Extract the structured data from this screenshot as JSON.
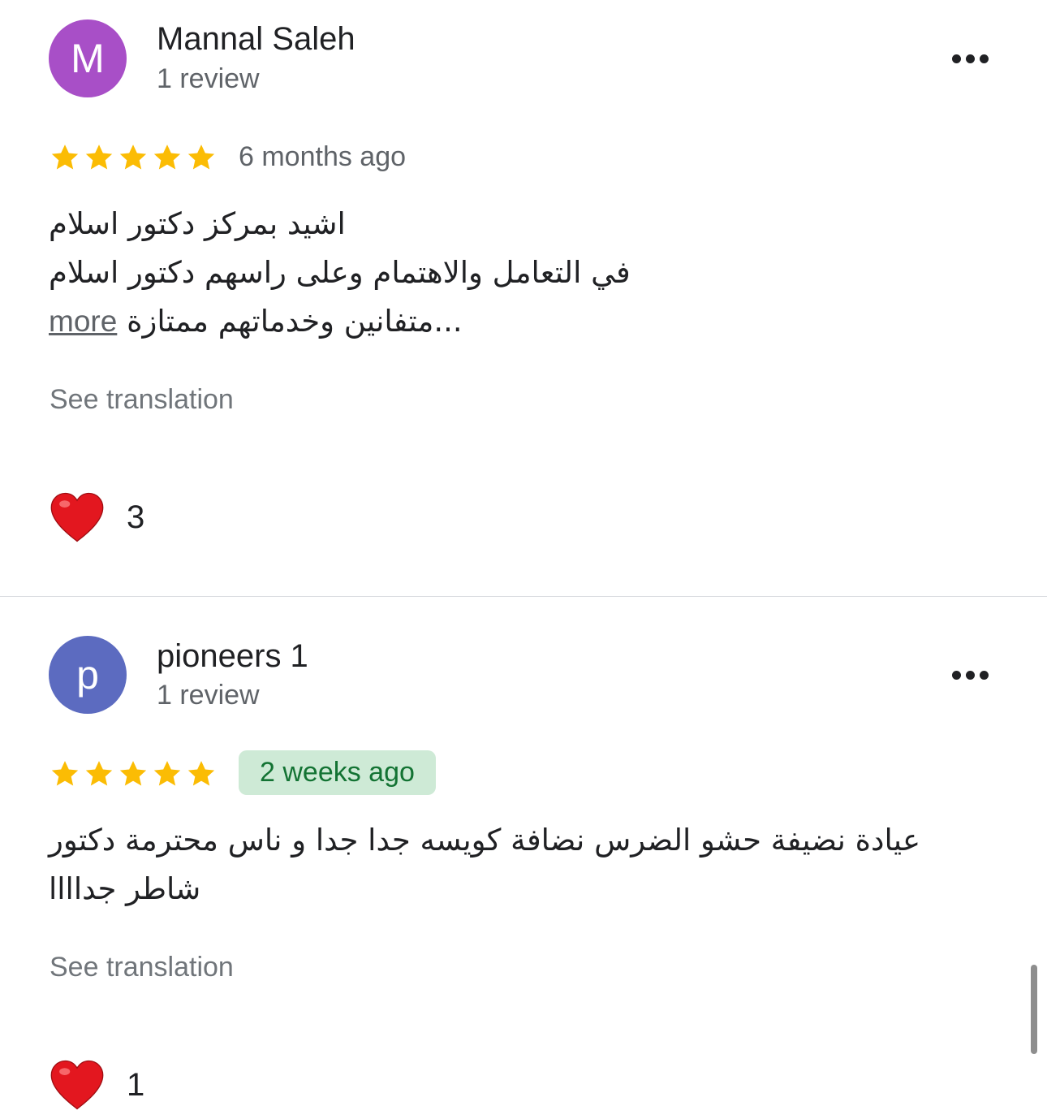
{
  "colors": {
    "avatar_m": "#a84fc7",
    "avatar_p": "#5c6bc0",
    "star": "#fbbc04",
    "heart": "#e3171f",
    "new_badge_bg": "#ceead6",
    "new_badge_text": "#137333"
  },
  "menu_icon": "more-horiz-icon",
  "star_icon": "star-icon",
  "heart_icon": "heart-icon",
  "reviews": [
    {
      "avatar_letter": "M",
      "name": "Mannal Saleh",
      "review_count": "1 review",
      "rating": 5,
      "time": "6 months ago",
      "text_lines": [
        "اشيد بمركز دكتور اسلام",
        "في التعامل والاهتمام وعلى راسهم دكتور اسلام",
        "متفانين وخدماتهم ممتازة..."
      ],
      "more_label": "more",
      "see_translation": "See translation",
      "likes": "3"
    },
    {
      "avatar_letter": "p",
      "name": "pioneers 1",
      "review_count": "1 review",
      "rating": 5,
      "time": "2 weeks ago",
      "text_lines": [
        "عيادة نضيفة حشو الضرس نضافة كويسه جدا جدا و ناس محترمة دكتور",
        "شاطر جداااا"
      ],
      "see_translation": "See translation",
      "likes": "1"
    }
  ]
}
